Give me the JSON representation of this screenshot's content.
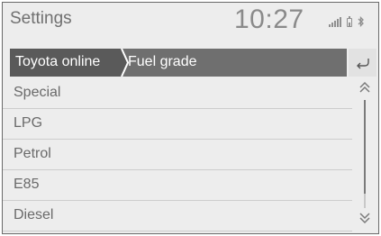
{
  "status": {
    "title": "Settings",
    "time": "10:27",
    "icons": [
      "signal-icon",
      "battery-icon",
      "bluetooth-icon"
    ]
  },
  "breadcrumb": {
    "items": [
      {
        "label": "Toyota online"
      },
      {
        "label": "Fuel grade"
      }
    ]
  },
  "back_icon": "back-arrow-icon",
  "list": {
    "items": [
      {
        "label": "Special"
      },
      {
        "label": "LPG"
      },
      {
        "label": "Petrol"
      },
      {
        "label": "E85"
      },
      {
        "label": "Diesel"
      }
    ]
  },
  "scrollbar": {
    "position": 0,
    "up_icon": "double-chevron-up-icon",
    "down_icon": "double-chevron-down-icon"
  },
  "colors": {
    "background": "#ededed",
    "breadcrumb_bar": "#6f6f6f",
    "breadcrumb_active": "#5a5a5a",
    "text": "#6a6a6a"
  }
}
